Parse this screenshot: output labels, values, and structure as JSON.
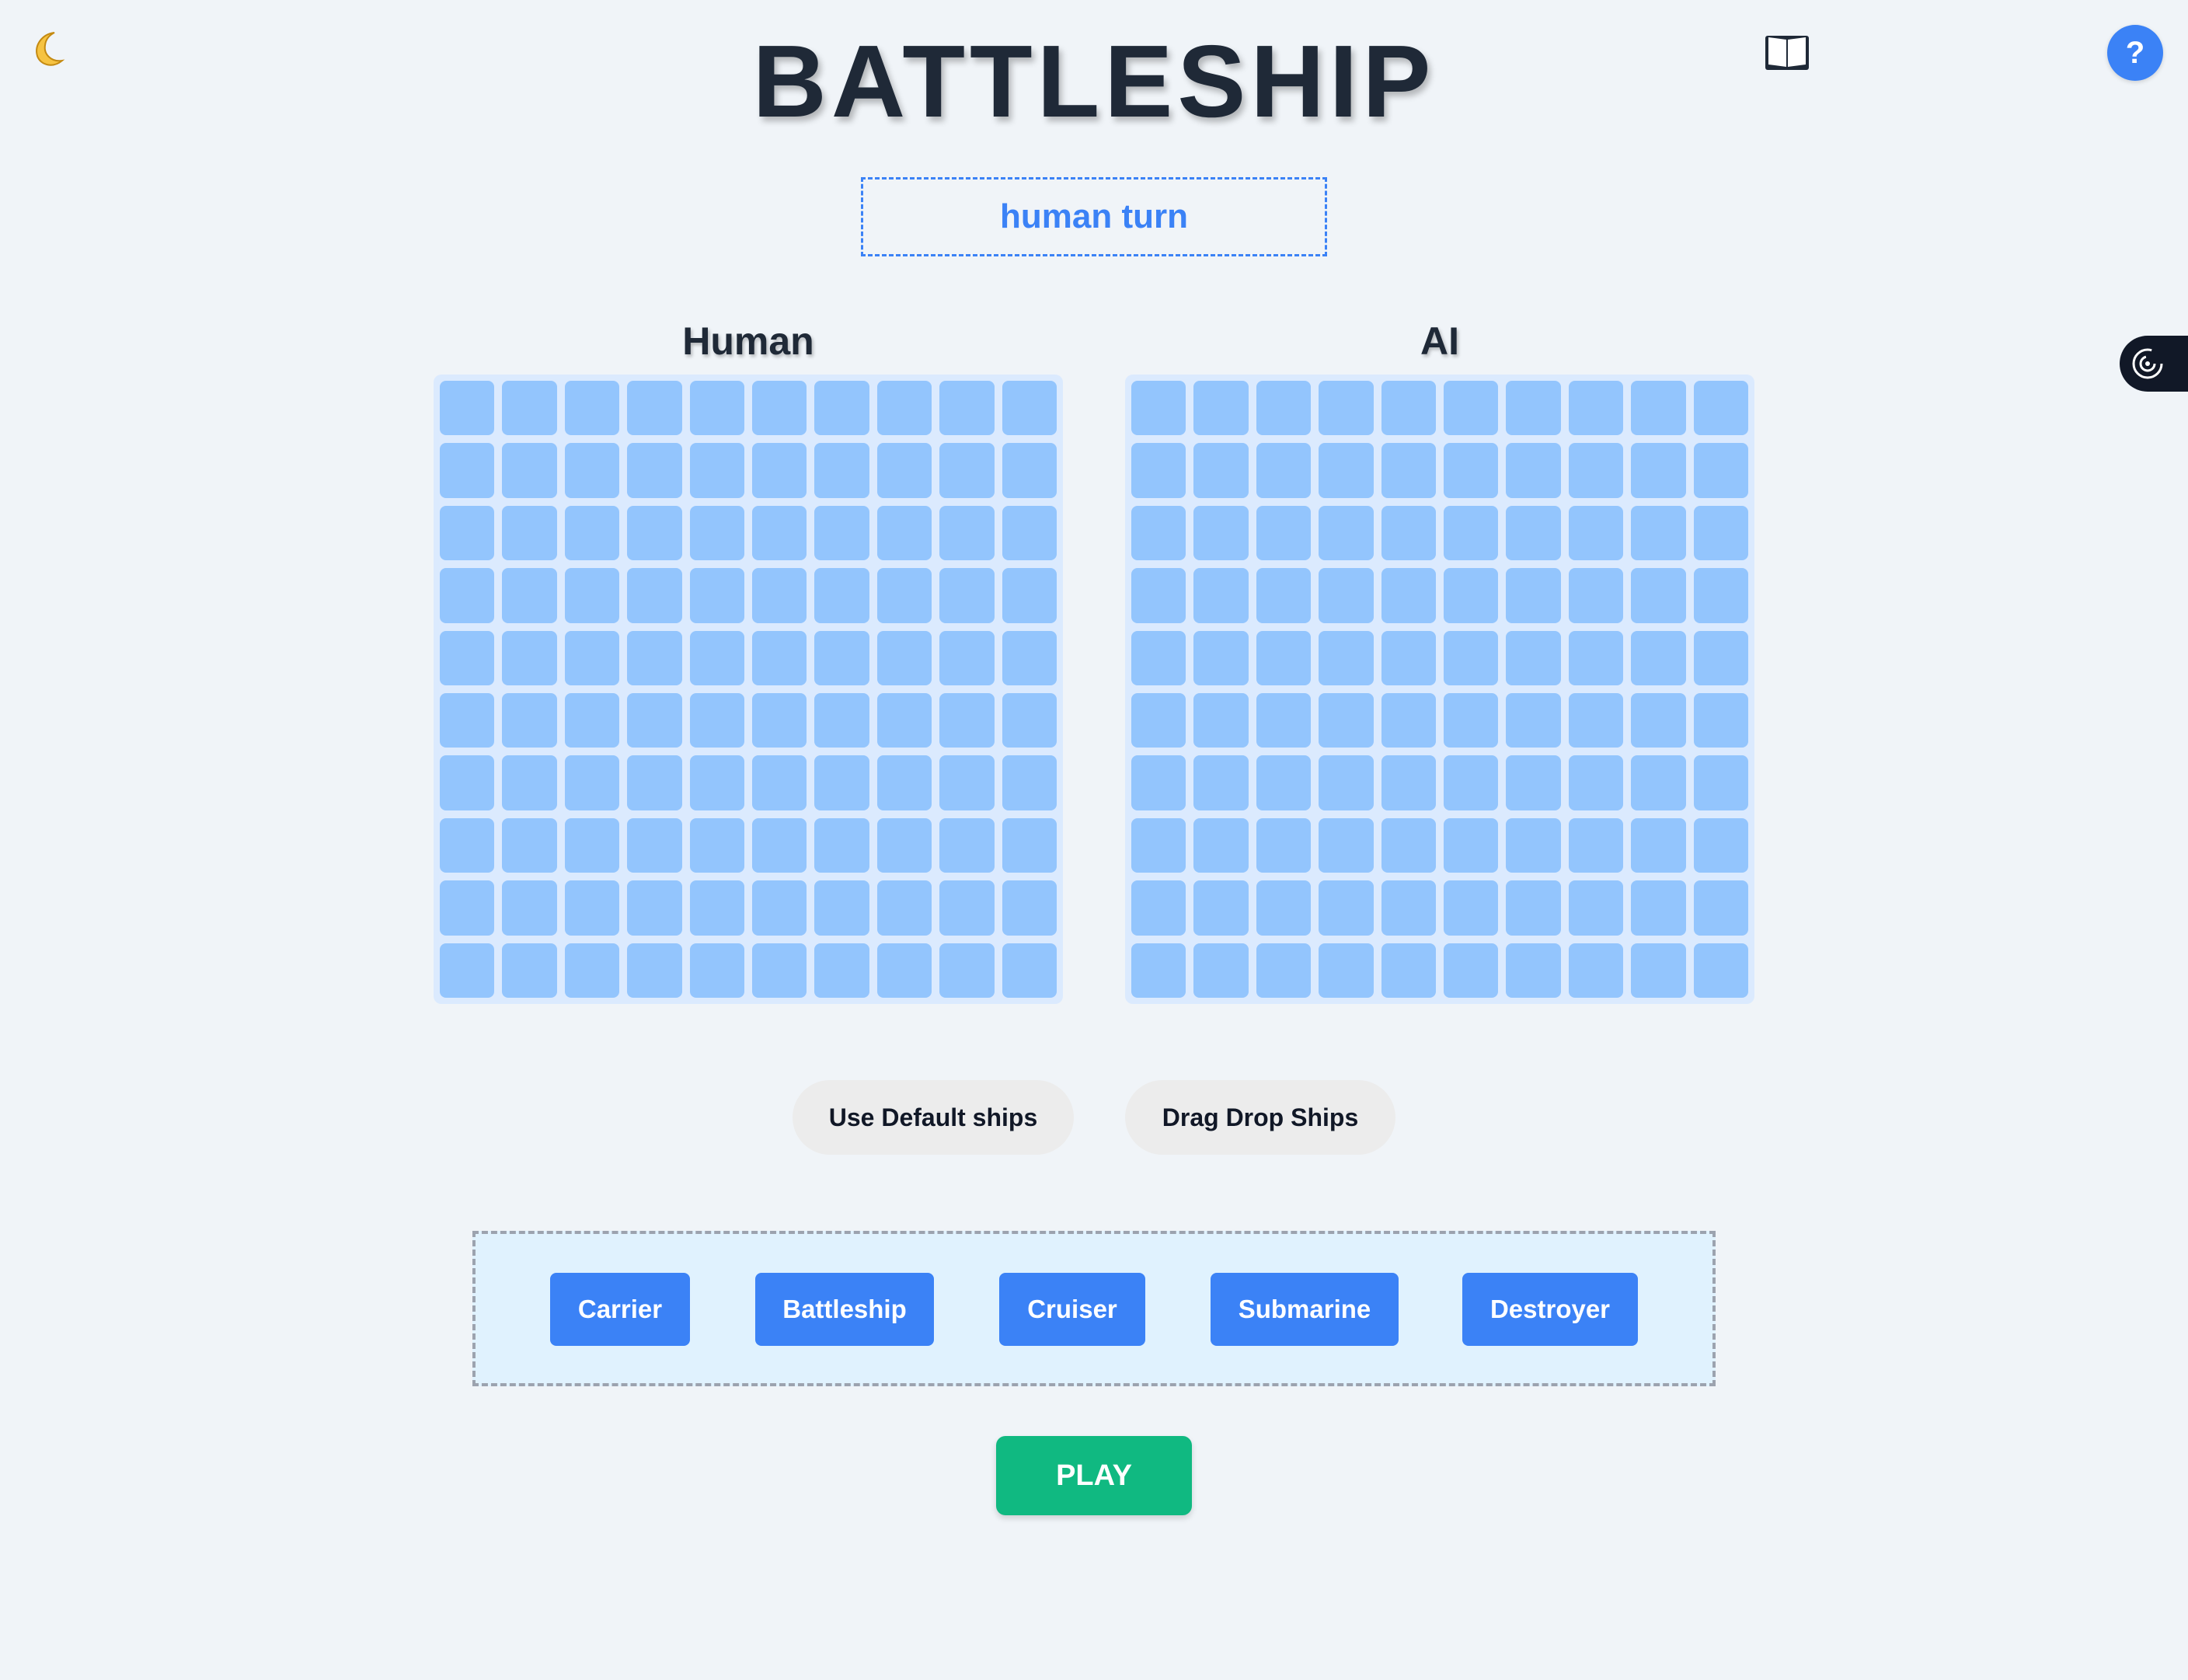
{
  "header": {
    "title": "BATTLESHIP",
    "status": "human turn",
    "theme_toggle_icon": "moon-icon",
    "rules_icon": "book-icon",
    "help_label": "?",
    "side_widget_icon": "spiral-icon"
  },
  "boards": {
    "human": {
      "label": "Human",
      "rows": 10,
      "cols": 10
    },
    "ai": {
      "label": "AI",
      "rows": 10,
      "cols": 10
    }
  },
  "placement": {
    "default_label": "Use Default ships",
    "drag_label": "Drag Drop Ships"
  },
  "ships": [
    {
      "label": "Carrier"
    },
    {
      "label": "Battleship"
    },
    {
      "label": "Cruiser"
    },
    {
      "label": "Submarine"
    },
    {
      "label": "Destroyer"
    }
  ],
  "play_label": "PLAY",
  "colors": {
    "background": "#f0f4f8",
    "accent": "#3b82f6",
    "cell": "#93c5fd",
    "board_bg": "#dbeafe",
    "play": "#10b981",
    "title": "#1f2937"
  }
}
